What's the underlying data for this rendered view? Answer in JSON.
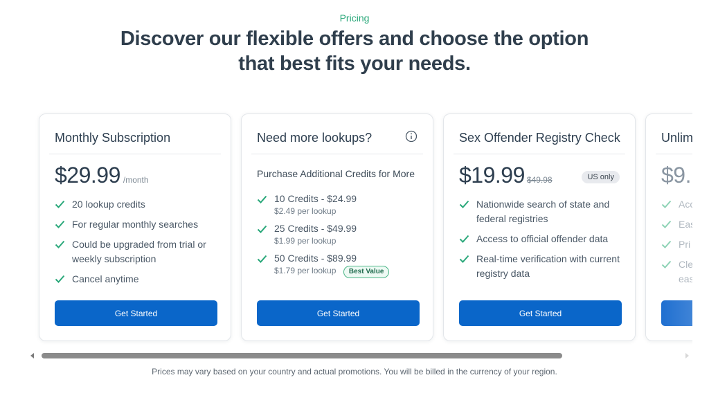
{
  "eyebrow": "Pricing",
  "headline": "Discover our flexible offers and choose the option that best fits your needs.",
  "accent_color": "#0a66c9",
  "check_color": "#2aa87a",
  "cards": [
    {
      "title": "Monthly Subscription",
      "price": "$29.99",
      "period": "/month",
      "features": [
        "20 lookup credits",
        "For regular monthly searches",
        "Could be upgraded from trial or weekly subscription",
        "Cancel anytime"
      ],
      "button": "Get Started"
    },
    {
      "title": "Need more lookups?",
      "info_icon": "info-icon",
      "subtitle": "Purchase Additional Credits for More",
      "credits": [
        {
          "label": "10 Credits - $24.99",
          "per": "$2.49 per lookup"
        },
        {
          "label": "25 Credits - $49.99",
          "per": "$1.99 per lookup"
        },
        {
          "label": "50 Credits - $89.99",
          "per": "$1.79 per lookup",
          "badge": "Best Value"
        }
      ],
      "button": "Get Started"
    },
    {
      "title": "Sex Offender Registry Check",
      "price": "$19.99",
      "old_price": "$49.98",
      "badge": "US only",
      "features": [
        "Nationwide search of state and federal registries",
        "Access to official offender data",
        "Real-time verification with current registry data"
      ],
      "button": "Get Started"
    },
    {
      "title": "Unlim",
      "price": "$9.",
      "features": [
        "Acc",
        "Eas",
        "Pri",
        "Cle",
        "eas"
      ]
    }
  ],
  "footnote": "Prices may vary based on your country and actual promotions. You will be billed in the currency of your region."
}
